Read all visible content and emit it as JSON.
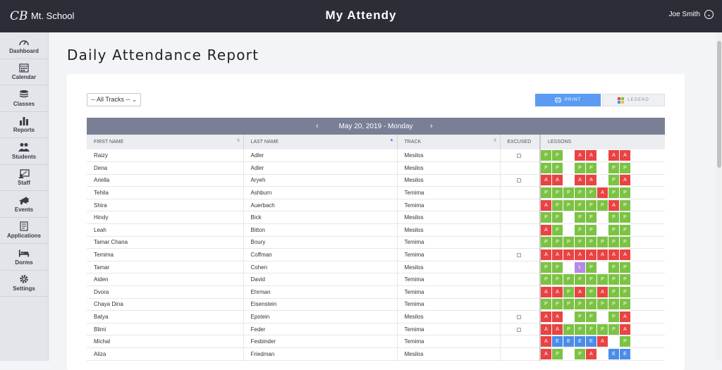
{
  "header": {
    "school_name": "Mt. School",
    "logo_text": "CB",
    "app_title": "My Attendy",
    "user_name": "Joe Smith"
  },
  "sidebar": {
    "items": [
      {
        "label": "Dashboard",
        "icon": "dashboard-icon"
      },
      {
        "label": "Calendar",
        "icon": "calendar-icon"
      },
      {
        "label": "Classes",
        "icon": "classes-icon"
      },
      {
        "label": "Reports",
        "icon": "reports-icon"
      },
      {
        "label": "Students",
        "icon": "students-icon"
      },
      {
        "label": "Staff",
        "icon": "staff-icon"
      },
      {
        "label": "Events",
        "icon": "events-icon"
      },
      {
        "label": "Applications",
        "icon": "applications-icon"
      },
      {
        "label": "Dorms",
        "icon": "dorms-icon"
      },
      {
        "label": "Settings",
        "icon": "settings-icon"
      }
    ]
  },
  "page": {
    "title": "Daily Attendance Report"
  },
  "filters": {
    "track_select": "-- All Tracks --"
  },
  "buttons": {
    "print": "PRINT",
    "legend": "LEGEND"
  },
  "date_nav": {
    "date": "May 20, 2019 - Monday",
    "prev": "‹",
    "next": "›"
  },
  "table": {
    "columns": [
      "FIRST NAME",
      "LAST NAME",
      "TRACK",
      "EXCUSED",
      "LESSONS"
    ],
    "rows": [
      {
        "first": "Raizy",
        "last": "Adler",
        "track": "Mesilos",
        "excused": true,
        "lessons": [
          "P",
          "P",
          "",
          "A",
          "A",
          "",
          "A",
          "A"
        ]
      },
      {
        "first": "Dena",
        "last": "Adler",
        "track": "Mesilos",
        "excused": false,
        "lessons": [
          "P",
          "P",
          "",
          "P",
          "P",
          "",
          "P",
          "P"
        ]
      },
      {
        "first": "Ariella",
        "last": "Aryeh",
        "track": "Mesilos",
        "excused": true,
        "lessons": [
          "A",
          "A",
          "",
          "A",
          "A",
          "",
          "P",
          "A"
        ]
      },
      {
        "first": "Tehila",
        "last": "Ashburn",
        "track": "Temima",
        "excused": false,
        "lessons": [
          "P",
          "P",
          "P",
          "P",
          "P",
          "A",
          "P",
          "P"
        ]
      },
      {
        "first": "Shira",
        "last": "Auerbach",
        "track": "Temima",
        "excused": false,
        "lessons": [
          "A",
          "P",
          "P",
          "P",
          "P",
          "P",
          "A",
          "P"
        ]
      },
      {
        "first": "Hindy",
        "last": "Bick",
        "track": "Mesilos",
        "excused": false,
        "lessons": [
          "P",
          "P",
          "",
          "P",
          "P",
          "",
          "P",
          "P"
        ]
      },
      {
        "first": "Leah",
        "last": "Bitton",
        "track": "Mesilos",
        "excused": false,
        "lessons": [
          "A",
          "P",
          "",
          "P",
          "P",
          "",
          "P",
          "P"
        ]
      },
      {
        "first": "Tamar Chana",
        "last": "Boury",
        "track": "Temima",
        "excused": false,
        "lessons": [
          "P",
          "P",
          "P",
          "P",
          "P",
          "P",
          "P",
          "P"
        ]
      },
      {
        "first": "Temima",
        "last": "Coffman",
        "track": "Temima",
        "excused": true,
        "lessons": [
          "A",
          "A",
          "A",
          "A",
          "A",
          "A",
          "A",
          "A"
        ]
      },
      {
        "first": "Tamar",
        "last": "Cohen",
        "track": "Mesilos",
        "excused": false,
        "lessons": [
          "P",
          "P",
          "",
          "L",
          "P",
          "",
          "P",
          "P"
        ]
      },
      {
        "first": "Aiden",
        "last": "David",
        "track": "Temima",
        "excused": false,
        "lessons": [
          "P",
          "P",
          "P",
          "P",
          "P",
          "P",
          "P",
          "P"
        ]
      },
      {
        "first": "Dvora",
        "last": "Ehrman",
        "track": "Temima",
        "excused": false,
        "lessons": [
          "A",
          "A",
          "P",
          "A",
          "P",
          "A",
          "P",
          "P"
        ]
      },
      {
        "first": "Chaya Dina",
        "last": "Eisenstein",
        "track": "Temima",
        "excused": false,
        "lessons": [
          "P",
          "P",
          "P",
          "P",
          "P",
          "P",
          "P",
          "P"
        ]
      },
      {
        "first": "Batya",
        "last": "Epstein",
        "track": "Mesilos",
        "excused": true,
        "lessons": [
          "A",
          "A",
          "",
          "P",
          "P",
          "",
          "P",
          "A"
        ]
      },
      {
        "first": "Blimi",
        "last": "Feder",
        "track": "Temima",
        "excused": true,
        "lessons": [
          "A",
          "A",
          "P",
          "P",
          "P",
          "P",
          "P",
          "A"
        ]
      },
      {
        "first": "Michal",
        "last": "Fesbinder",
        "track": "Temima",
        "excused": false,
        "lessons": [
          "A",
          "E",
          "E",
          "E",
          "E",
          "A",
          "",
          "P"
        ]
      },
      {
        "first": "Aliza",
        "last": "Friedman",
        "track": "Mesilos",
        "excused": false,
        "lessons": [
          "A",
          "P",
          "",
          "P",
          "A",
          "",
          "E",
          "E"
        ]
      }
    ]
  },
  "colors": {
    "present": "#7cc243",
    "absent": "#e94343",
    "excused": "#4a8de8",
    "late": "#b38ae6",
    "header_bg": "#2b2d37",
    "primary": "#5b9cf2"
  }
}
